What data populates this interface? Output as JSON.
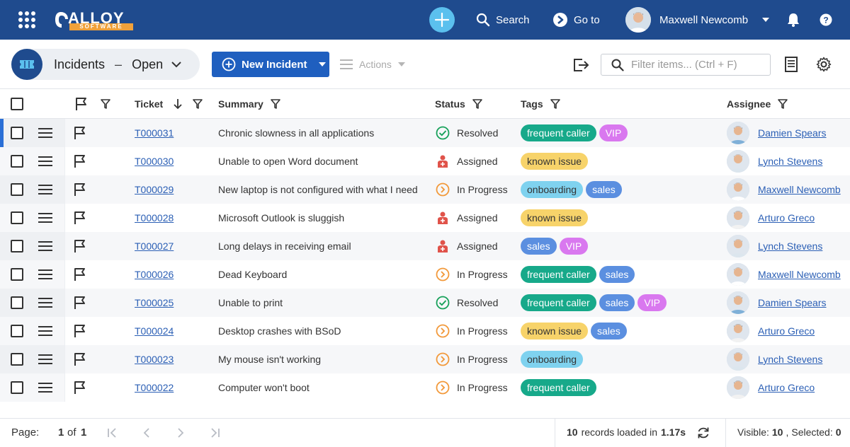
{
  "topbar": {
    "logo_word": "ALLOY",
    "logo_sub": "SOFTWARE",
    "search_label": "Search",
    "goto_label": "Go to",
    "user_name": "Maxwell Newcomb"
  },
  "toolbar": {
    "view_title": "Incidents",
    "view_dash": "–",
    "view_state": "Open",
    "new_button_label": "New Incident",
    "actions_label": "Actions",
    "filter_placeholder": "Filter items... (Ctrl + F)"
  },
  "grid": {
    "columns": {
      "ticket": "Ticket",
      "summary": "Summary",
      "status": "Status",
      "tags": "Tags",
      "assignee": "Assignee"
    },
    "rows": [
      {
        "ticket": "T000031",
        "summary": "Chronic slowness in all applications",
        "status": "Resolved",
        "status_kind": "resolved",
        "tags": [
          "frequent caller",
          "VIP"
        ],
        "assignee": "Damien Spears",
        "selected": true
      },
      {
        "ticket": "T000030",
        "summary": "Unable to open Word document",
        "status": "Assigned",
        "status_kind": "assigned",
        "tags": [
          "known issue"
        ],
        "assignee": "Lynch Stevens"
      },
      {
        "ticket": "T000029",
        "summary": "New laptop is not configured with what I need",
        "status": "In Progress",
        "status_kind": "progress",
        "tags": [
          "onboarding",
          "sales"
        ],
        "assignee": "Maxwell Newcomb"
      },
      {
        "ticket": "T000028",
        "summary": "Microsoft Outlook is sluggish",
        "status": "Assigned",
        "status_kind": "assigned",
        "tags": [
          "known issue"
        ],
        "assignee": "Arturo Greco"
      },
      {
        "ticket": "T000027",
        "summary": "Long delays in receiving email",
        "status": "Assigned",
        "status_kind": "assigned",
        "tags": [
          "sales",
          "VIP"
        ],
        "assignee": "Lynch Stevens"
      },
      {
        "ticket": "T000026",
        "summary": "Dead Keyboard",
        "status": "In Progress",
        "status_kind": "progress",
        "tags": [
          "frequent caller",
          "sales"
        ],
        "assignee": "Maxwell Newcomb"
      },
      {
        "ticket": "T000025",
        "summary": "Unable to print",
        "status": "Resolved",
        "status_kind": "resolved",
        "tags": [
          "frequent caller",
          "sales",
          "VIP"
        ],
        "assignee": "Damien Spears"
      },
      {
        "ticket": "T000024",
        "summary": "Desktop crashes with BSoD",
        "status": "In Progress",
        "status_kind": "progress",
        "tags": [
          "known issue",
          "sales"
        ],
        "assignee": "Arturo Greco"
      },
      {
        "ticket": "T000023",
        "summary": "My mouse isn't working",
        "status": "In Progress",
        "status_kind": "progress",
        "tags": [
          "onboarding"
        ],
        "assignee": "Lynch Stevens"
      },
      {
        "ticket": "T000022",
        "summary": "Computer won't boot",
        "status": "In Progress",
        "status_kind": "progress",
        "tags": [
          "frequent caller"
        ],
        "assignee": "Arturo Greco"
      }
    ]
  },
  "tag_colors": {
    "frequent caller": {
      "bg": "#17a98a",
      "fg": "#ffffff"
    },
    "VIP": {
      "bg": "#d978ef",
      "fg": "#ffffff"
    },
    "known issue": {
      "bg": "#f7d36a",
      "fg": "#333333"
    },
    "onboarding": {
      "bg": "#7fd2ef",
      "fg": "#333333"
    },
    "sales": {
      "bg": "#5b8fe0",
      "fg": "#ffffff"
    }
  },
  "status_colors": {
    "resolved": "#17a15a",
    "assigned": "#e0534a",
    "progress": "#f2993a"
  },
  "footer": {
    "page_label": "Page:",
    "page_current": "1",
    "page_of": "of",
    "page_total": "1",
    "records_count": "10",
    "records_text": "records loaded in",
    "records_time": "1.17s",
    "visible_label": "Visible:",
    "visible_count": "10",
    "selected_label": "Selected:",
    "selected_count": "0"
  },
  "colors": {
    "header_bg": "#1f4b8e",
    "primary_button": "#1f5fbf",
    "add_button": "#5bc0ee",
    "link": "#2b5fb5"
  }
}
